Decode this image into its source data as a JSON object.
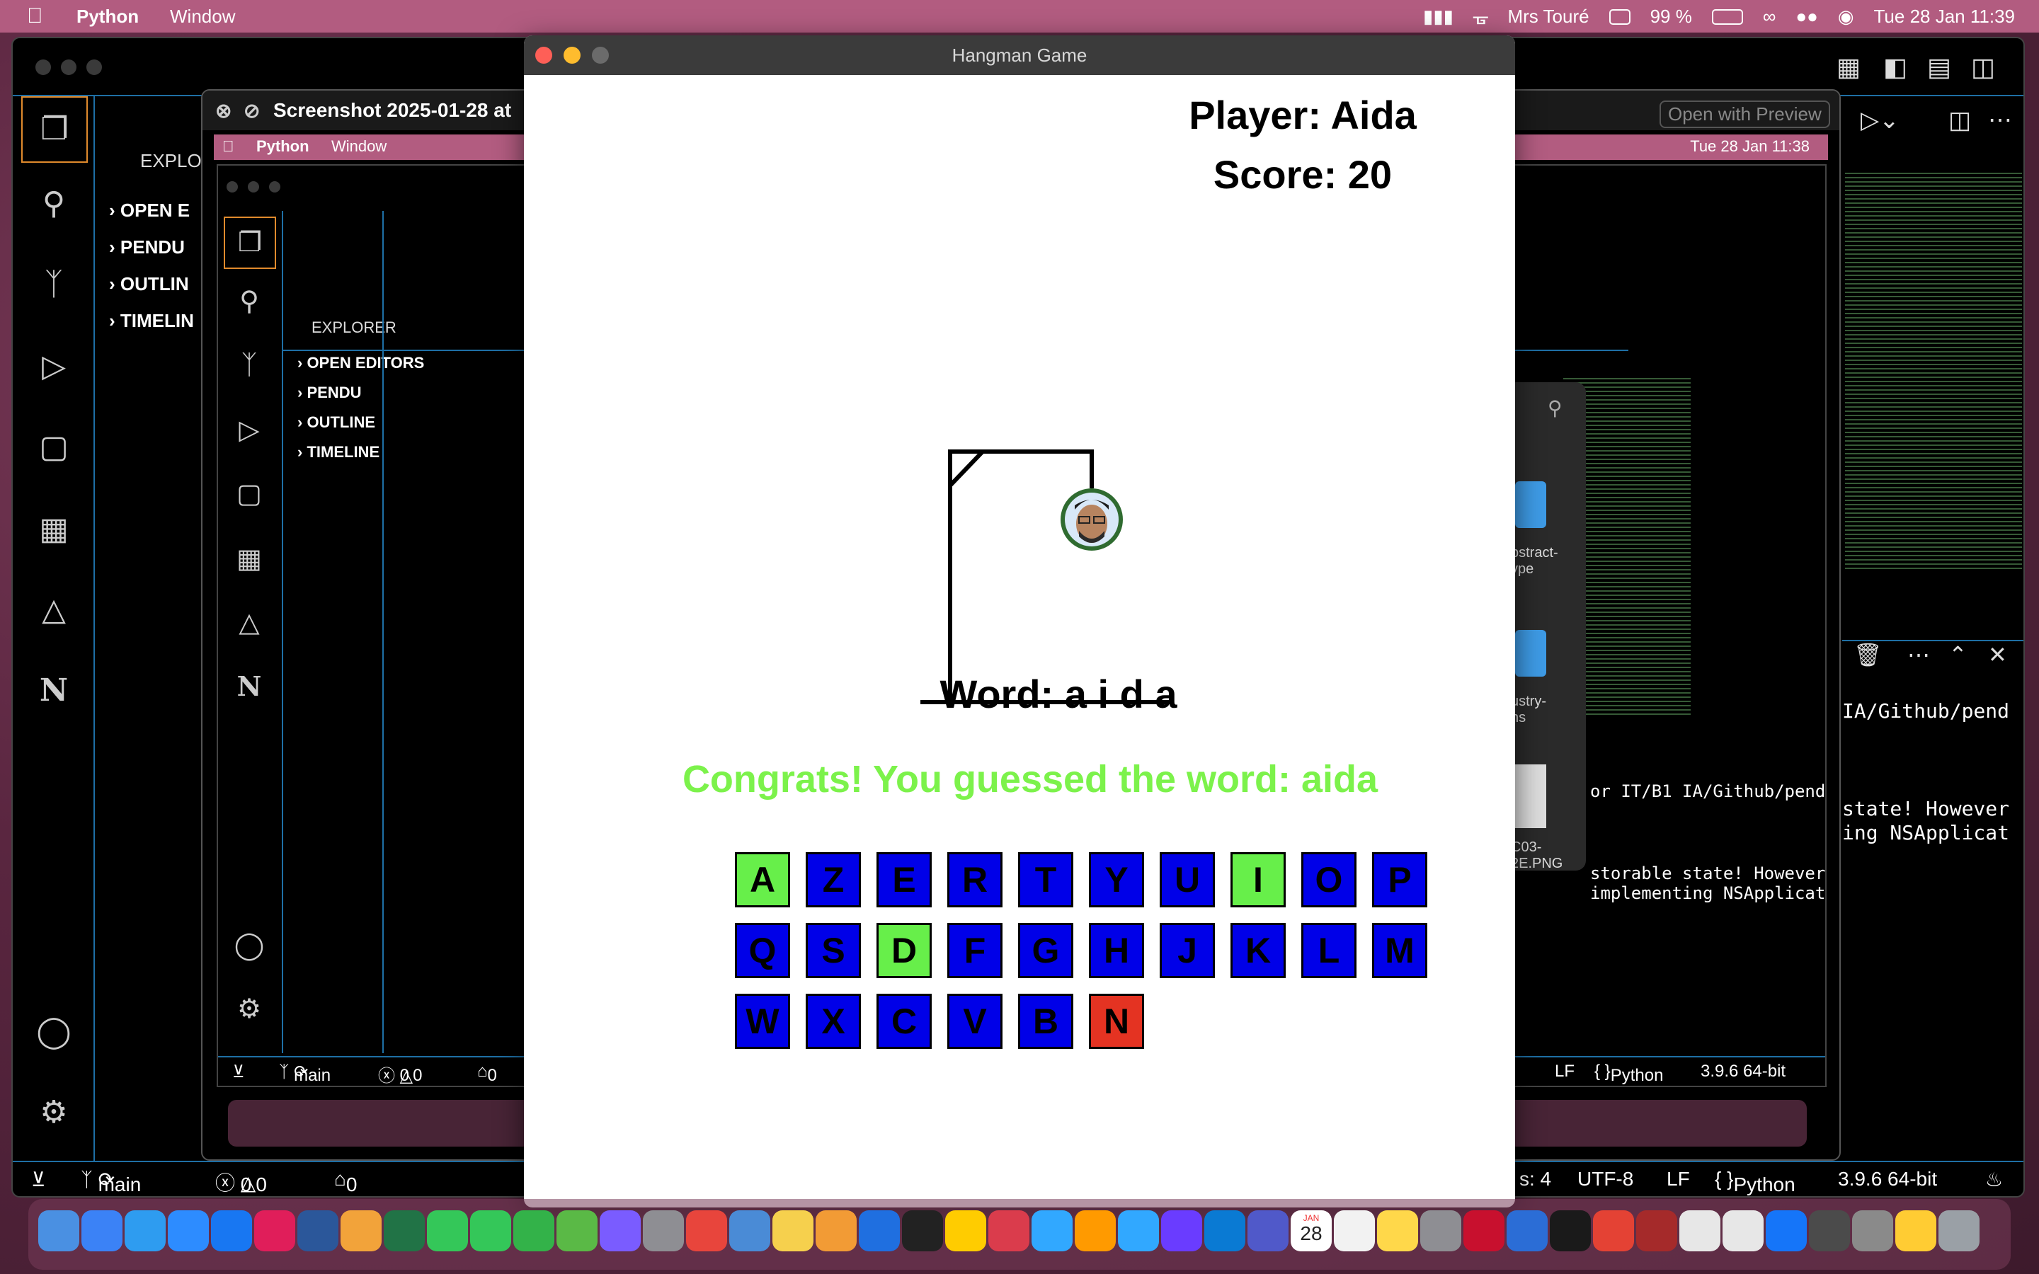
{
  "menubar": {
    "app": "Python",
    "window_menu": "Window",
    "user": "Mrs Touré",
    "battery": "99 %",
    "datetime": "Tue 28 Jan  11:39"
  },
  "vscode_back": {
    "explorer_title": "EXPLOR",
    "sections": [
      "OPEN E",
      "PENDU",
      "OUTLIN",
      "TIMELIN"
    ],
    "open_with_preview": "Open with Preview",
    "status": {
      "branch": "main",
      "errors": "0",
      "warnings": "0",
      "ports": "0",
      "spaces": "s: 4",
      "encoding": "UTF-8",
      "eol": "LF",
      "language": "Python",
      "interpreter": "3.9.6 64-bit"
    },
    "terminal_lines": [
      "IA/Github/pend",
      "",
      "",
      "state! However",
      "ing NSApplicat"
    ]
  },
  "screenshot_window": {
    "title": "Screenshot 2025-01-28 at",
    "inner_menubar": {
      "app": "Python",
      "window_menu": "Window",
      "datetime": "Tue 28 Jan  11:38"
    },
    "explorer_title": "EXPLORER",
    "sections": [
      "OPEN EDITORS",
      "PENDU",
      "OUTLINE",
      "TIMELINE"
    ],
    "status": {
      "branch": "main",
      "errors": "0",
      "warnings": "0",
      "ports": "0",
      "eol": "LF",
      "language": "Python",
      "interpreter": "3.9.6 64-bit"
    },
    "terminal_lines": [
      "or IT/B1 IA/Github/pend",
      "",
      "",
      "storable state! However",
      "implementing NSApplicat"
    ],
    "finder_items": [
      "bstract-\nype",
      "ustry-\nns",
      "C03-\n2E.PNG"
    ]
  },
  "hangman": {
    "window_title": "Hangman Game",
    "player_label": "Player: Aida",
    "score_label": "Score: 20",
    "word_label": "Word: a i d a",
    "message": "Congrats! You guessed the word: aida",
    "colors": {
      "unused": "#0000e8",
      "correct": "#67ef4a",
      "wrong": "#e43322",
      "message": "#7cf24b"
    },
    "keyboard_rows": [
      [
        {
          "letter": "A",
          "state": "correct"
        },
        {
          "letter": "Z",
          "state": "unused"
        },
        {
          "letter": "E",
          "state": "unused"
        },
        {
          "letter": "R",
          "state": "unused"
        },
        {
          "letter": "T",
          "state": "unused"
        },
        {
          "letter": "Y",
          "state": "unused"
        },
        {
          "letter": "U",
          "state": "unused"
        },
        {
          "letter": "I",
          "state": "correct"
        },
        {
          "letter": "O",
          "state": "unused"
        },
        {
          "letter": "P",
          "state": "unused"
        }
      ],
      [
        {
          "letter": "Q",
          "state": "unused"
        },
        {
          "letter": "S",
          "state": "unused"
        },
        {
          "letter": "D",
          "state": "correct"
        },
        {
          "letter": "F",
          "state": "unused"
        },
        {
          "letter": "G",
          "state": "unused"
        },
        {
          "letter": "H",
          "state": "unused"
        },
        {
          "letter": "J",
          "state": "unused"
        },
        {
          "letter": "K",
          "state": "unused"
        },
        {
          "letter": "L",
          "state": "unused"
        },
        {
          "letter": "M",
          "state": "unused"
        }
      ],
      [
        {
          "letter": "W",
          "state": "unused"
        },
        {
          "letter": "X",
          "state": "unused"
        },
        {
          "letter": "C",
          "state": "unused"
        },
        {
          "letter": "V",
          "state": "unused"
        },
        {
          "letter": "B",
          "state": "unused"
        },
        {
          "letter": "N",
          "state": "wrong"
        }
      ]
    ]
  },
  "dock": {
    "apps": [
      "finder-icon",
      "mail-icon",
      "safari-icon",
      "zoom-icon",
      "trello-icon",
      "slack-icon",
      "word-icon",
      "photos-icon",
      "excel-icon",
      "messages-icon",
      "facetime-icon",
      "numbers-icon",
      "maps-icon",
      "siri-icon",
      "launchpad-icon",
      "chrome-icon",
      "mindnode-icon",
      "notes-icon",
      "pages-icon",
      "keynote-icon",
      "stocks-icon",
      "freeform-icon",
      "creative-cloud-icon",
      "photoshop-icon",
      "illustrator-icon",
      "lightroom-icon",
      "app-icon",
      "vscode-icon",
      "teams-icon",
      "calendar-icon",
      "reminders-icon",
      "notes2-icon",
      "settings-icon",
      "acrobat-icon",
      "pronto-icon",
      "terminal-icon",
      "anydesk-icon",
      "dictionary-icon",
      "preview-icon",
      "preview2-icon",
      "xcode-icon",
      "activity-icon",
      "keychain-icon",
      "cyberduck-icon",
      "trash-icon"
    ],
    "calendar_day": "28",
    "calendar_month": "JAN"
  }
}
